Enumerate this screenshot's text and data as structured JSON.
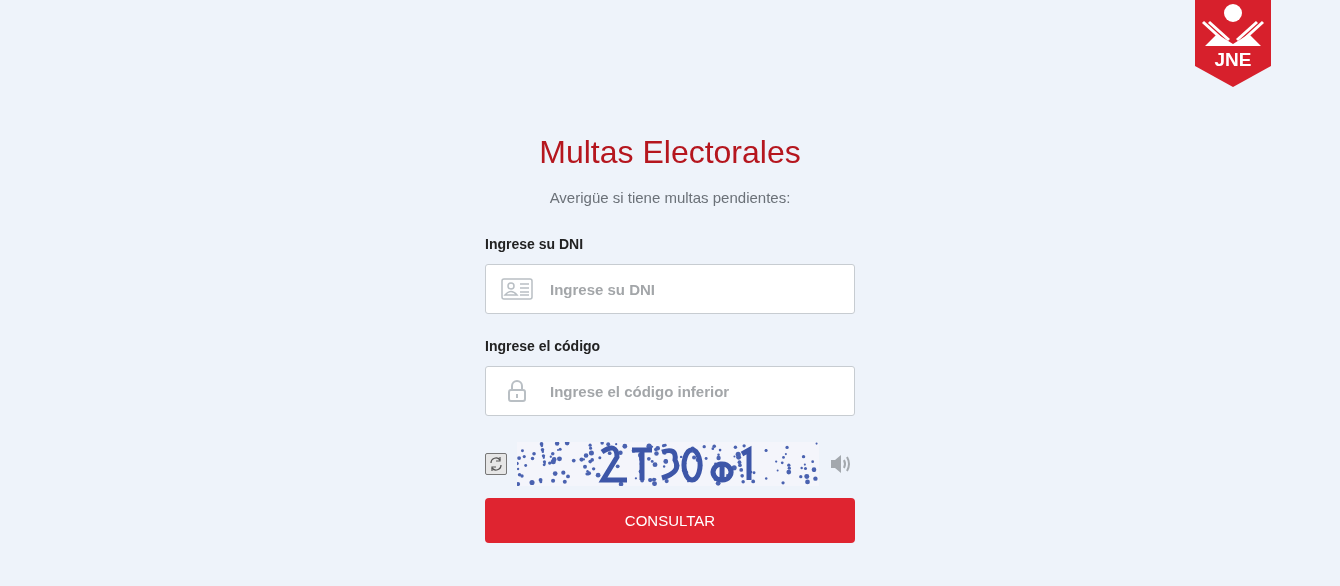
{
  "logo": {
    "text": "JNE"
  },
  "title": "Multas Electorales",
  "subtitle": "Averigüe si tiene multas pendientes:",
  "fields": [
    {
      "kind": "id",
      "label": "Ingrese su DNI",
      "placeholder": "Ingrese su DNI"
    },
    {
      "kind": "lock",
      "label": "Ingrese el código",
      "placeholder": "Ingrese el código inferior"
    }
  ],
  "button": "CONSULTAR"
}
